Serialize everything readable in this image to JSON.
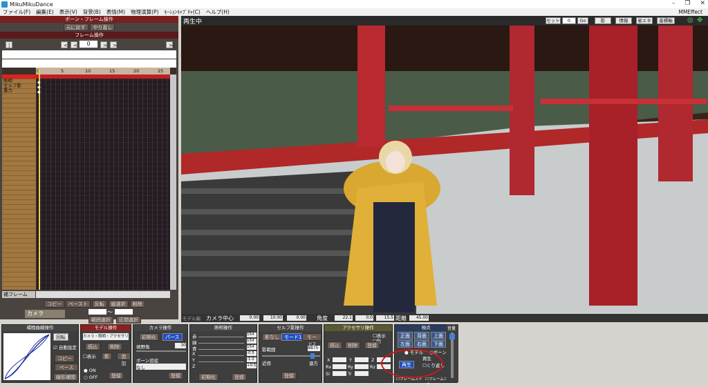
{
  "titlebar": {
    "app_title": "MikuMikuDance"
  },
  "menu": {
    "items": [
      "ファイル(F)",
      "編集(E)",
      "表示(V)",
      "背景(B)",
      "表情(M)",
      "物理演算(P)",
      "ﾓｰｼｮﾝｷｬﾌﾟﾁｬ(C)",
      "ヘルプ(H)"
    ],
    "right": "MMEffect"
  },
  "left_panel": {
    "header": "ボーン・フレーム操作",
    "undo": "元に戻す",
    "redo": "やり直し",
    "frame_header": "フレーム操作",
    "frame_value": "0",
    "ruler": [
      "0",
      "5",
      "10",
      "15",
      "20",
      "25"
    ],
    "tracks": [
      "照明",
      "セルフ影",
      "重力"
    ],
    "dropdown_label": "補フレーム",
    "buttons": [
      "コピー",
      "ペースト",
      "反転",
      "縦選択",
      "削除"
    ],
    "camera_label": "カメラ",
    "tilde": "〜",
    "range_btns": [
      "範囲選択",
      "区間選択"
    ]
  },
  "viewport": {
    "status": "再生中",
    "set_label": "セット",
    "frame_input": "0",
    "go_label": "Go",
    "buttons": [
      "影",
      "情報",
      "省エネ",
      "座標軸"
    ]
  },
  "bottom_bar": {
    "model_label": "モデル編",
    "camera_center": "カメラ中心",
    "center_vals": [
      "0.00",
      "10.00",
      "0.00"
    ],
    "angle_label": "角度",
    "angle_vals": [
      "22.1",
      "0.0",
      "15.5"
    ],
    "distance_label": "距離",
    "distance_val": "45.00"
  },
  "panels": {
    "interp": {
      "title": "補間曲線操作",
      "rotation": "回転",
      "auto": "自動設定",
      "copy": "コピー",
      "paste": "ペースト",
      "linear": "線形補間"
    },
    "model": {
      "title": "モデル操作",
      "select": "カメラ・照明・アクセサリ",
      "register": "読込",
      "delete": "削除",
      "display": "表示",
      "shadow": "影",
      "add": "追加",
      "on": "ON",
      "off": "OFF",
      "register_btn": "登録"
    },
    "camera": {
      "title": "カメラ操作",
      "init": "初期化",
      "perspective": "パース",
      "fov_label": "視野角",
      "fov_val": "30",
      "follow_label": "ボーン追従",
      "follow_val": "なし",
      "register_btn": "登録"
    },
    "light": {
      "title": "照明操作",
      "labels": [
        "赤",
        "緑",
        "青",
        "X",
        "Y",
        "Z"
      ],
      "vals": [
        "154",
        "154",
        "154",
        "-0.5",
        "-1.0",
        "+0.5"
      ],
      "init": "初期化",
      "register_btn": "登録"
    },
    "selfshadow": {
      "title": "セルフ影操作",
      "none": "影なし",
      "mode1": "モード1",
      "mode2": "モード2",
      "range_label": "影範囲",
      "range_val": "8875",
      "near": "近傍",
      "far": "遠方",
      "register_btn": "登録"
    },
    "accessory": {
      "title": "アクセサリ操作",
      "display": "表示",
      "shadow": "影",
      "load": "読込",
      "delete": "削除",
      "register_btn": "登録",
      "xyz": [
        "X",
        "Y",
        "Z"
      ],
      "rot": [
        "Rx",
        "Ry",
        "Rz"
      ],
      "si": "Si",
      "tr": "Tr"
    },
    "viewpoint": {
      "title": "視点",
      "front": "正面",
      "back": "背面",
      "top": "上面",
      "left": "左面",
      "right": "右面",
      "bottom": "下面",
      "follow": "追従",
      "model": "モデル",
      "bone": "ボーン",
      "play_label": "再生",
      "play_btn": "再生",
      "repeat": "くり返し",
      "frame_start": "フレームスト",
      "frame_stop": "フレームストップ",
      "volume": "音量"
    }
  }
}
